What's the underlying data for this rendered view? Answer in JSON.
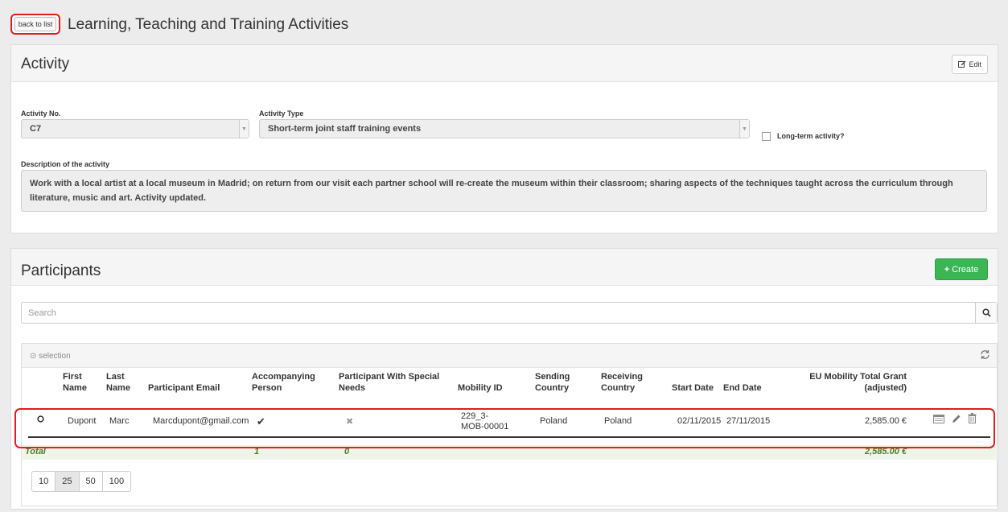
{
  "header": {
    "back_label": "back to list",
    "title": "Learning, Teaching and Training Activities"
  },
  "activity": {
    "panel_title": "Activity",
    "edit_label": "Edit",
    "activity_no_label": "Activity No.",
    "activity_no_value": "C7",
    "activity_type_label": "Activity Type",
    "activity_type_value": "Short-term joint staff training events",
    "long_term_label": "Long-term activity?",
    "long_term_checked": false,
    "description_label": "Description of the activity",
    "description_value": "Work with a local artist at a local museum in Madrid; on return from our visit each partner school will re-create the museum within their classroom; sharing aspects of the techniques taught across the curriculum through literature, music and art. Activity updated."
  },
  "participants": {
    "panel_title": "Participants",
    "create_label": "Create",
    "search_placeholder": "Search",
    "selection_label": "selection",
    "columns": {
      "first_name": [
        "First",
        "Name"
      ],
      "last_name": [
        "Last",
        "Name"
      ],
      "email": "Participant Email",
      "accompanying": [
        "Accompanying",
        "Person"
      ],
      "special_needs": [
        "Participant With Special",
        "Needs"
      ],
      "mobility_id": "Mobility ID",
      "sending_country": [
        "Sending",
        "Country"
      ],
      "receiving_country": [
        "Receiving",
        "Country"
      ],
      "start_date": "Start Date",
      "end_date": "End Date",
      "grant": [
        "EU Mobility Total Grant",
        "(adjusted)"
      ]
    },
    "rows": [
      {
        "first_name": "Dupont",
        "last_name": "Marc",
        "email": "Marcdupont@gmail.com",
        "accompanying": "✔",
        "special_needs": "✖",
        "mobility_id": [
          "229_3-",
          "MOB-00001"
        ],
        "sending_country": "Poland",
        "receiving_country": "Poland",
        "start_date": "02/11/2015",
        "end_date": "27/11/2015",
        "grant": "2,585.00 €"
      }
    ],
    "totals": {
      "label": "Total",
      "accompanying": "1",
      "special_needs": "0",
      "grant": "2,585.00 €"
    },
    "page_sizes": [
      "10",
      "25",
      "50",
      "100"
    ],
    "active_page_size": "25"
  },
  "colors": {
    "highlight": "#e31b23",
    "create_green": "#3cb554",
    "total_green": "#4a7d2a"
  }
}
